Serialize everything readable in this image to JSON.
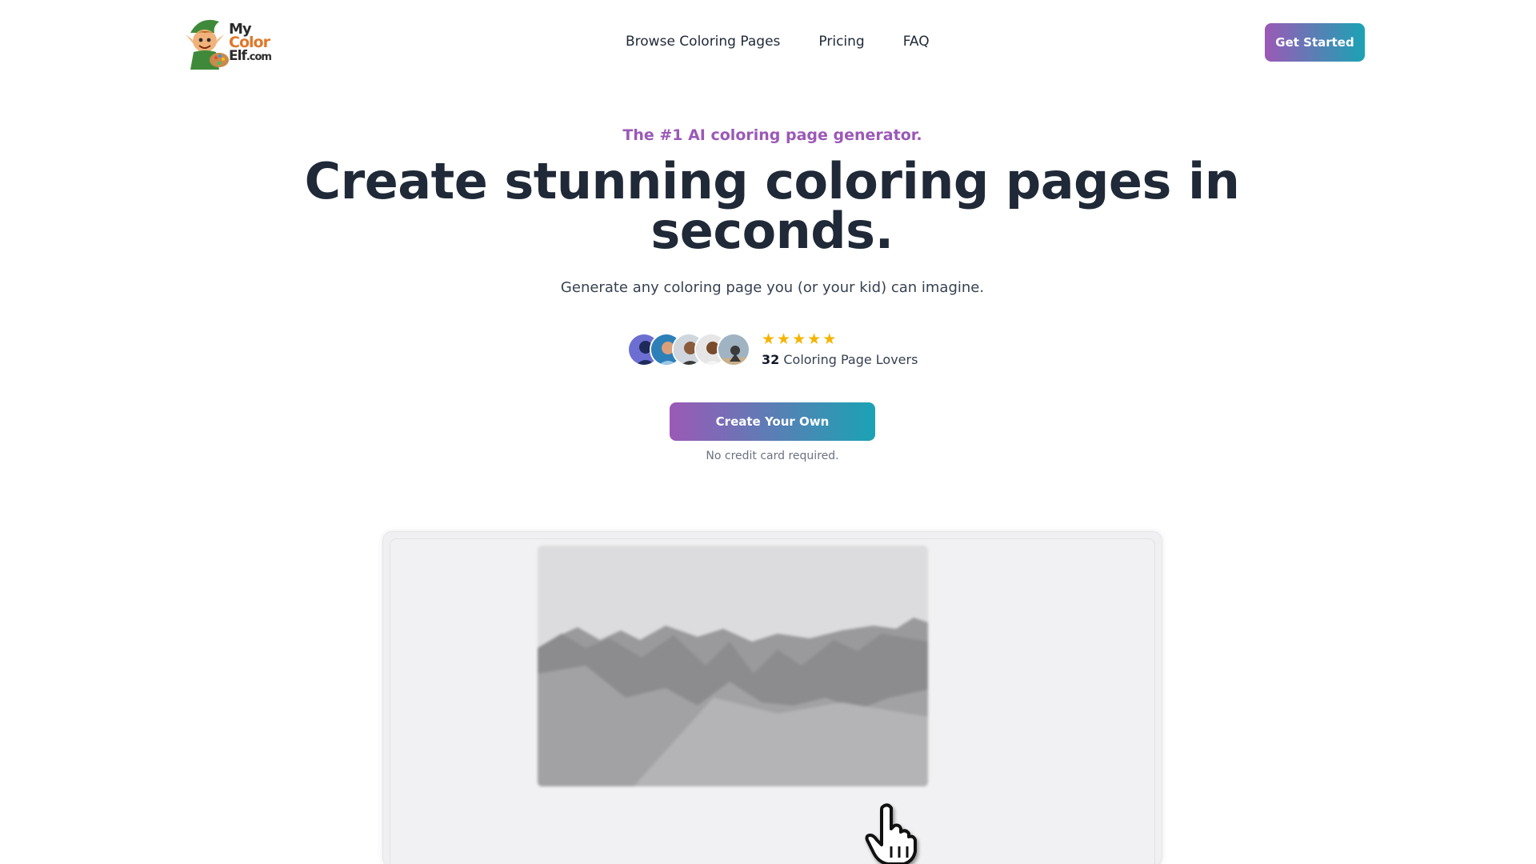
{
  "brand": {
    "logo_line1": "My",
    "logo_line2": "Color",
    "logo_line3": "Elf",
    "logo_line3_suffix": ".com",
    "gradient_start": "#9b59b6",
    "gradient_end": "#1aa3b4",
    "accent": "#9b59b6"
  },
  "nav": {
    "items": [
      "Browse Coloring Pages",
      "Pricing",
      "FAQ"
    ]
  },
  "header": {
    "cta_label": "Get Started"
  },
  "hero": {
    "tagline": "The #1 AI coloring page generator.",
    "headline": "Create stunning coloring pages in seconds.",
    "subhead": "Generate any coloring page you (or your kid) can imagine.",
    "rating_stars": 5,
    "lovers_count": "32",
    "lovers_label": "Coloring Page Lovers",
    "cta_label": "Create Your Own",
    "cta_note": "No credit card required."
  },
  "icons": {
    "star": "star-icon",
    "cursor": "hand-pointer-icon"
  }
}
